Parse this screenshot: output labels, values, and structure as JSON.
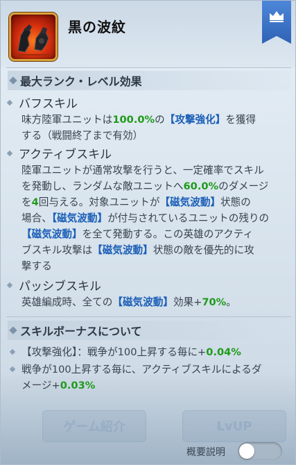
{
  "skill": {
    "name": "黒の波紋",
    "icon": "armored-fist-icon"
  },
  "bookmark_icon": "crown-icon",
  "max_rank_section": {
    "title": "最大ランク・レベル効果",
    "buff": {
      "title": "バフスキル",
      "text_1": "味方陸軍ユニットは",
      "value_1": "100.0%",
      "text_2": "の",
      "tag_1": "【攻撃強化】",
      "text_3": "を獲得",
      "text_4": "する（戦闘終了まで有効）"
    },
    "active": {
      "title": "アクティブスキル",
      "line1": "陸軍ユニットが通常攻撃を行うと、一定確率でスキル",
      "line2_a": "を発動し、ランダムな敵ユニットへ",
      "line2_value": "60.0%",
      "line2_b": "のダメージ",
      "line3_a": "を",
      "line3_value": "4",
      "line3_b": "回与える。対象ユニットが",
      "line3_tag": "【磁気波動】",
      "line3_c": "状態の",
      "line4_a": "場合、",
      "line4_tag": "【磁気波動】",
      "line4_b": "が付与されているユニットの残りの",
      "line5_tag": "【磁気波動】",
      "line5_b": "を全て発動する。この英雄のアクティ",
      "line6_a": "ブスキル攻撃は",
      "line6_tag": "【磁気波動】",
      "line6_b": "状態の敵を優先的に攻",
      "line7": "撃する"
    },
    "passive": {
      "title": "パッシブスキル",
      "text_1": "英雄編成時、全ての",
      "tag_1": "【磁気波動】",
      "text_2": "効果+",
      "value_1": "70%",
      "text_3": "。"
    }
  },
  "bonus_section": {
    "title": "スキルボーナスについて",
    "item1_a": "【攻撃強化】：戦争が100上昇する毎に+",
    "item1_value": "0.04%",
    "item2_a": "戦争が100上昇する毎に、アクティブスキルによるダ",
    "item2_b": "メージ+",
    "item2_value": "0.03%"
  },
  "footer": {
    "left_button": "ゲーム紹介",
    "right_button": "LvUP",
    "toggle_label": "概要説明",
    "toggle_on": false
  },
  "colors": {
    "highlight_green": "#1f9a1a",
    "highlight_blue": "#1b5fb8",
    "bookmark_blue": "#3a70c4"
  }
}
